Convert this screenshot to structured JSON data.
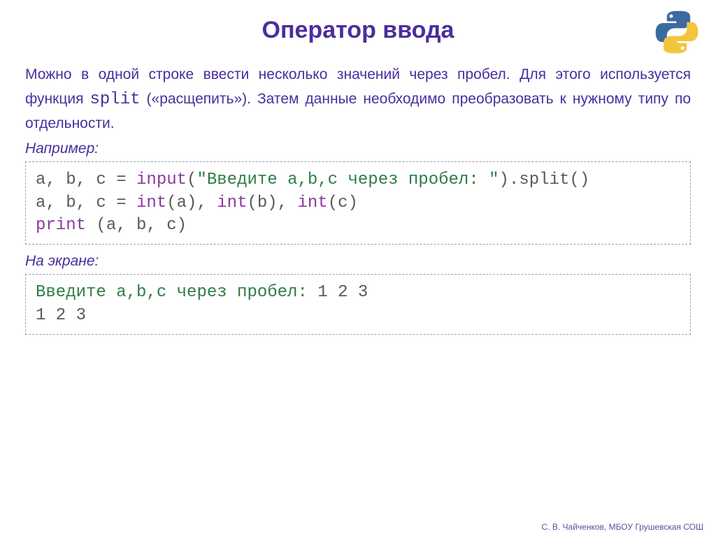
{
  "title": "Оператор ввода",
  "logo_name": "python-logo",
  "para": {
    "t1": "Можно в одной строке ввести несколько значений через пробел. Для этого используется функция ",
    "code": "split",
    "t2": " («расщепить»). Затем данные необходимо преобразовать к нужному типу по отдельности."
  },
  "example_label": "Например:",
  "code1": {
    "l1a": "a, b, c = ",
    "l1b": "input",
    "l1c": "(",
    "l1d": "\"Введите a,b,c через пробел: \"",
    "l1e": ").split()",
    "l2a": "a, b, c = ",
    "l2b": "int",
    "l2c": "(a), ",
    "l2d": "int",
    "l2e": "(b), ",
    "l2f": "int",
    "l2g": "(c)",
    "l3a": "print",
    "l3b": " (a, b, c)"
  },
  "screen_label": "На экране:",
  "code2": {
    "l1a": "Введите a,b,c через пробел: ",
    "l1b": "1 2 3",
    "l2": "1 2 3"
  },
  "footer": "С. В. Чайченков, МБОУ Грушевская СОШ"
}
